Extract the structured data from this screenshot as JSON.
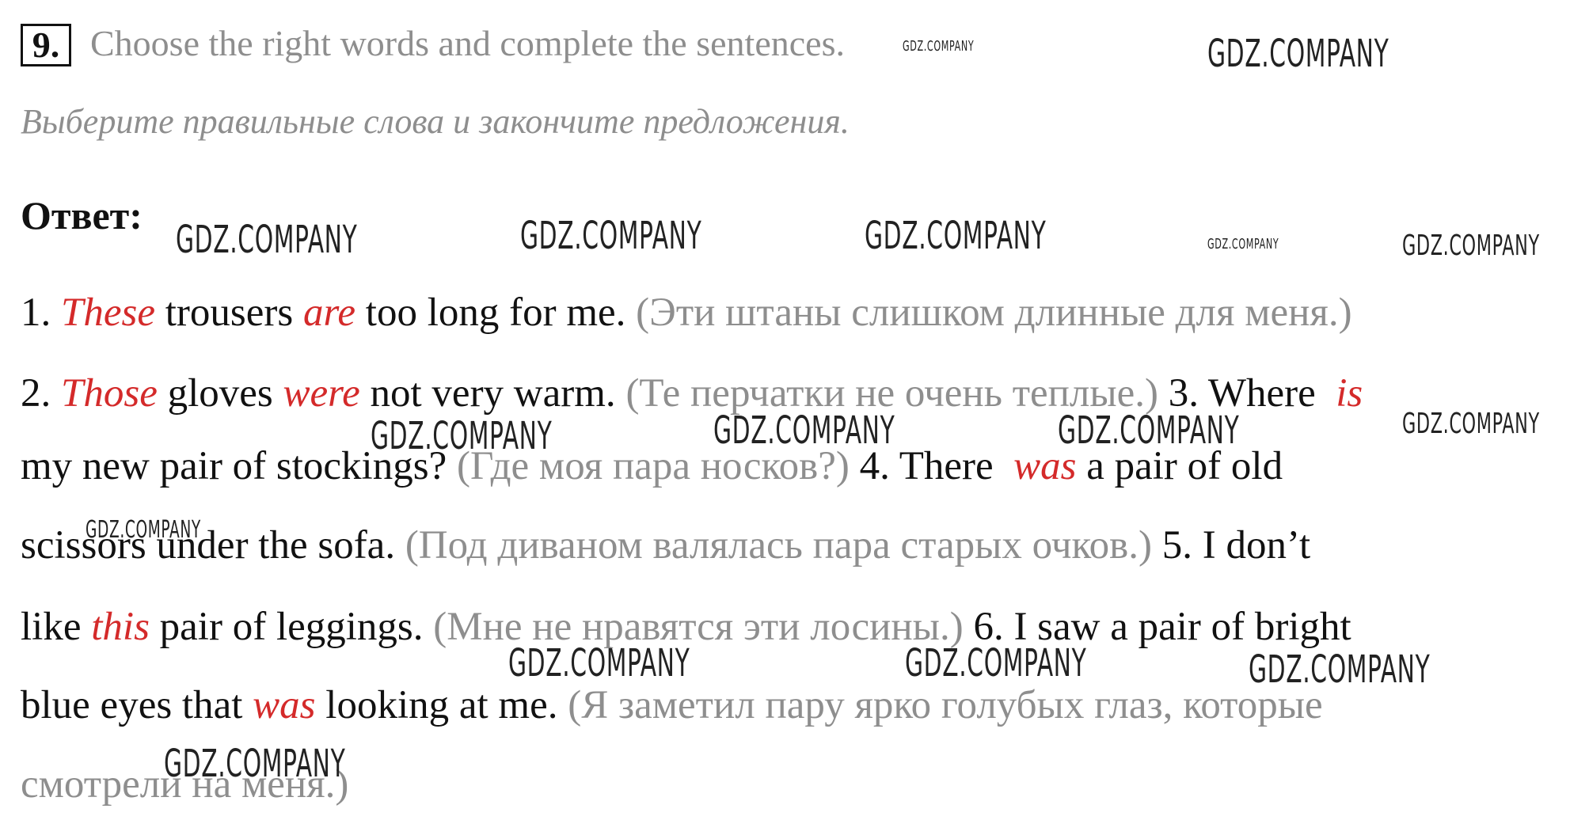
{
  "task": {
    "number": "9.",
    "instruction": "Choose the right words and complete the sentences.",
    "translation": "Выберите правильные слова и закончите предложения."
  },
  "answer_label": "Ответ:",
  "lines": [
    {
      "t1": "1. ",
      "r1": "These",
      "t2": " trousers ",
      "r2": "are",
      "t3": " too long for me. ",
      "g1": "(Эти штаны слишком длинные для меня.)"
    },
    {
      "t1": "2. ",
      "r1": "Those",
      "t2": " gloves ",
      "r2": "were",
      "t3": " not very warm. ",
      "g1": "(Те перчатки не очень теплые.)",
      "t4": " 3. Where ",
      "r3": "is"
    },
    {
      "t1": "my new pair of stockings? ",
      "g1": "(Где моя пара носков?)",
      "t2": " 4. There ",
      "r1": "was",
      "t3": " a pair of old"
    },
    {
      "t1": "scissors under the sofa. ",
      "g1": "(Под диваном валялась пара старых очков.)",
      "t2": " 5. I don’t"
    },
    {
      "t1": "like ",
      "r1": "this",
      "t2": " pair of leggings. ",
      "g1": "(Мне не нравятся эти лосины.)",
      "t3": " 6. I saw a pair of bright"
    },
    {
      "t1": "blue eyes that ",
      "r1": "was",
      "t2": " looking at me. ",
      "g1": "(Я заметил пару ярко голубых глаз, которые"
    },
    {
      "g1": "смотрели на меня.)"
    }
  ],
  "watermark": "GDZ.COMPANY"
}
